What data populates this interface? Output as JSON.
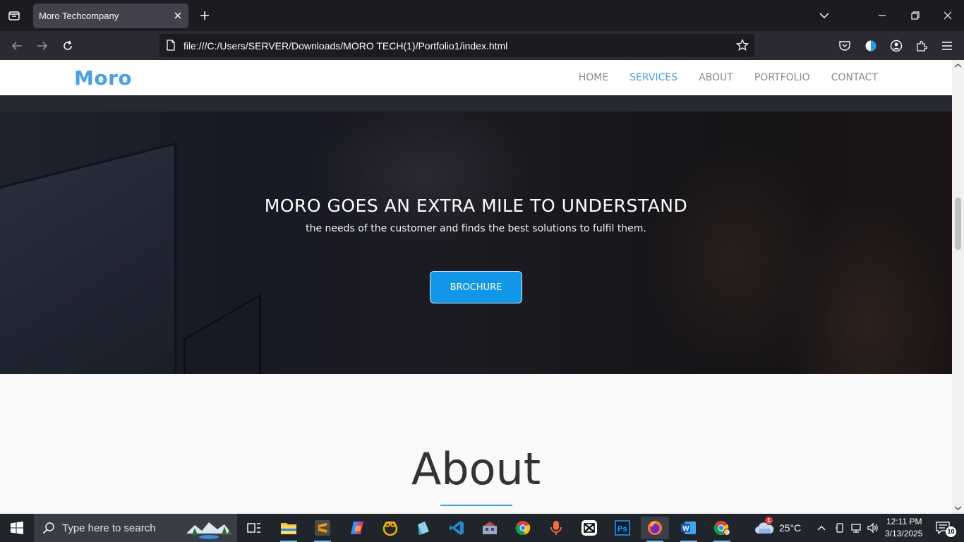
{
  "browser": {
    "tab_title": "Moro Techcompany",
    "url": "file:///C:/Users/SERVER/Downloads/MORO TECH(1)/Portfolio1/index.html"
  },
  "site": {
    "brand": "Moro",
    "nav": [
      {
        "label": "HOME",
        "active": false
      },
      {
        "label": "SERVICES",
        "active": true
      },
      {
        "label": "ABOUT",
        "active": false
      },
      {
        "label": "PORTFOLIO",
        "active": false
      },
      {
        "label": "CONTACT",
        "active": false
      }
    ],
    "hero": {
      "title": "MORO GOES AN EXTRA MILE TO UNDERSTAND",
      "subtitle": "the needs of the customer and finds the best solutions to fulfil them.",
      "button": "BROCHURE"
    },
    "about": {
      "title": "About"
    }
  },
  "colors": {
    "brand": "#4aa1de",
    "button": "#1296e8"
  },
  "taskbar": {
    "search_placeholder": "Type here to search",
    "weather": "25°C",
    "weather_badge": "1",
    "time": "12:11 PM",
    "date": "3/13/2025",
    "notifications": "10",
    "apps": [
      "task-view-icon",
      "file-explorer-icon",
      "sublime-text-icon",
      "copilot-icon",
      "paint-icon",
      "app-icon",
      "vscode-icon",
      "app-icon",
      "chrome-icon",
      "microphone-icon",
      "capcut-icon",
      "photoshop-icon",
      "firefox-icon",
      "word-icon",
      "chrome-profile-icon"
    ]
  }
}
